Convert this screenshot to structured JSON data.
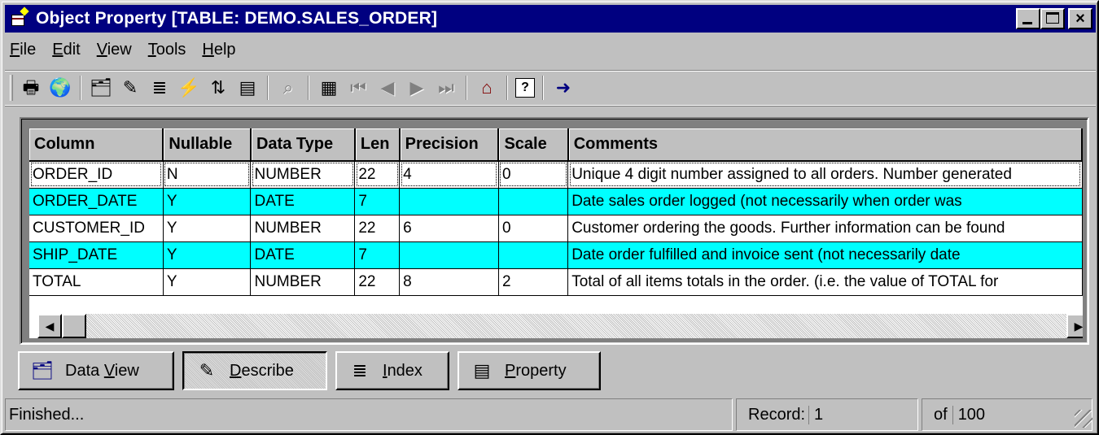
{
  "window": {
    "title": "Object Property  [TABLE:  DEMO.SALES_ORDER]",
    "controls": {
      "minimize": "_",
      "maximize": "□",
      "close": "×"
    }
  },
  "menu": [
    {
      "label": "File",
      "mnemonic": "F",
      "rest": "ile"
    },
    {
      "label": "Edit",
      "mnemonic": "E",
      "rest": "dit"
    },
    {
      "label": "View",
      "mnemonic": "V",
      "rest": "iew"
    },
    {
      "label": "Tools",
      "mnemonic": "T",
      "rest": "ools"
    },
    {
      "label": "Help",
      "mnemonic": "H",
      "rest": "elp"
    }
  ],
  "toolbar": {
    "icons": [
      {
        "name": "print-icon",
        "glyph": "🖶"
      },
      {
        "name": "globe-icon",
        "glyph": "🌍"
      },
      {
        "name": "data-view-icon",
        "glyph": "🗂"
      },
      {
        "name": "describe-icon",
        "glyph": "✎"
      },
      {
        "name": "index-icon",
        "glyph": "≣"
      },
      {
        "name": "run-index-icon",
        "glyph": "⚡"
      },
      {
        "name": "compare-icon",
        "glyph": "⇅"
      },
      {
        "name": "property-icon",
        "glyph": "▤"
      },
      {
        "name": "find-icon",
        "glyph": "⌕"
      },
      {
        "name": "report-icon",
        "glyph": "▦"
      },
      {
        "name": "first-record-icon",
        "glyph": "⏮"
      },
      {
        "name": "prev-record-icon",
        "glyph": "◀"
      },
      {
        "name": "next-record-icon",
        "glyph": "▶"
      },
      {
        "name": "last-record-icon",
        "glyph": "⏭"
      },
      {
        "name": "home-icon",
        "glyph": "⌂"
      },
      {
        "name": "help-icon",
        "glyph": "?"
      },
      {
        "name": "exit-icon",
        "glyph": "➜"
      }
    ]
  },
  "grid": {
    "columns": [
      "Column",
      "Nullable",
      "Data Type",
      "Len",
      "Precision",
      "Scale",
      "Comments"
    ],
    "rows": [
      [
        "ORDER_ID",
        "N",
        "NUMBER",
        "22",
        "4",
        "0",
        "Unique 4 digit number assigned to all orders.  Number generated"
      ],
      [
        "ORDER_DATE",
        "Y",
        "DATE",
        "7",
        "",
        "",
        "Date sales order logged (not necessarily when order was"
      ],
      [
        "CUSTOMER_ID",
        "Y",
        "NUMBER",
        "22",
        "6",
        "0",
        "Customer ordering the goods.  Further information can be found"
      ],
      [
        "SHIP_DATE",
        "Y",
        "DATE",
        "7",
        "",
        "",
        "Date order fulfilled and invoice sent (not necessarily date"
      ],
      [
        "TOTAL",
        "Y",
        "NUMBER",
        "22",
        "8",
        "2",
        "Total of all items totals in the order.  (i.e. the value of TOTAL for"
      ]
    ],
    "highlight_color": "#00ffff"
  },
  "tabs": [
    {
      "name": "data-view",
      "icon": "🗂",
      "pre": "Data ",
      "mnemonic": "V",
      "post": "iew"
    },
    {
      "name": "describe",
      "icon": "✎",
      "pre": "",
      "mnemonic": "D",
      "post": "escribe"
    },
    {
      "name": "index",
      "icon": "≣",
      "pre": "",
      "mnemonic": "I",
      "post": "ndex"
    },
    {
      "name": "property",
      "icon": "▤",
      "pre": "",
      "mnemonic": "P",
      "post": "roperty"
    }
  ],
  "status": {
    "message": "Finished...",
    "record_label": "Record:",
    "record_value": "1",
    "of_label": "of",
    "total": "100"
  }
}
